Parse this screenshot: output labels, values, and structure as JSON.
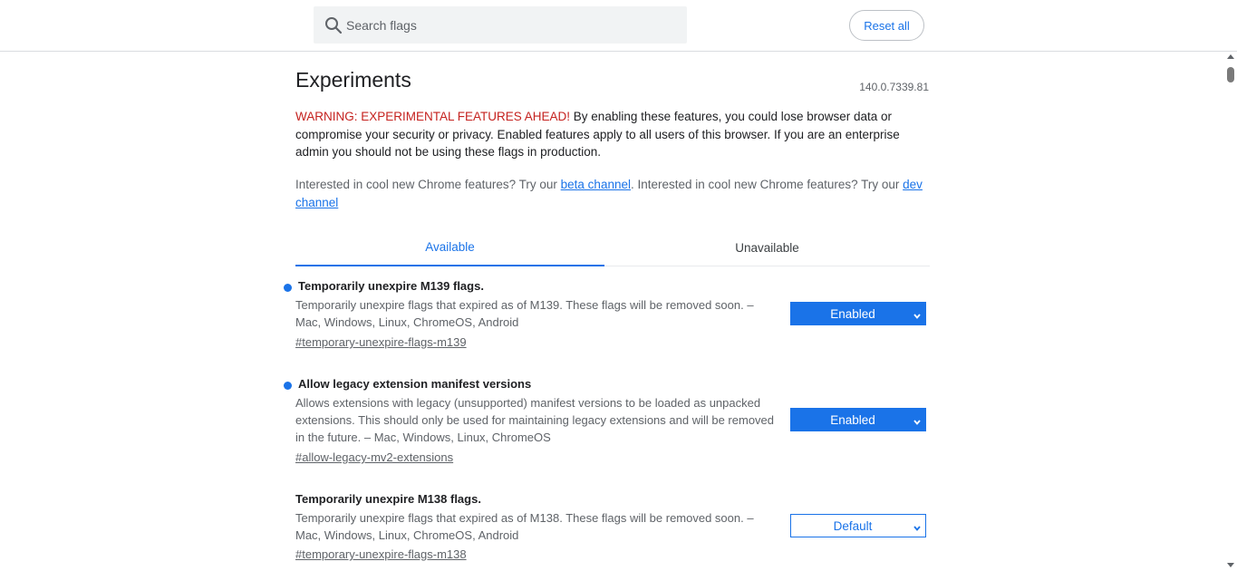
{
  "header": {
    "search_placeholder": "Search flags",
    "reset_label": "Reset all"
  },
  "page": {
    "title": "Experiments",
    "version": "140.0.7339.81",
    "warning_strong": "WARNING: EXPERIMENTAL FEATURES AHEAD!",
    "warning_text": " By enabling these features, you could lose browser data or compromise your security or privacy. Enabled features apply to all users of this browser. If you are an enterprise admin you should not be using these flags in production.",
    "promo_text_1": "Interested in cool new Chrome features? Try our ",
    "promo_link_1": "beta channel",
    "promo_text_2": ". Interested in cool new Chrome features? Try our ",
    "promo_link_2": "dev channel"
  },
  "tabs": [
    {
      "label": "Available",
      "active": true
    },
    {
      "label": "Unavailable",
      "active": false
    }
  ],
  "flags": [
    {
      "name": "Temporarily unexpire M139 flags.",
      "description": "Temporarily unexpire flags that expired as of M139. These flags will be removed soon. – Mac, Windows, Linux, ChromeOS, Android",
      "link": "#temporary-unexpire-flags-m139",
      "value": "Enabled",
      "modified": true
    },
    {
      "name": "Allow legacy extension manifest versions",
      "description": "Allows extensions with legacy (unsupported) manifest versions to be loaded as unpacked extensions. This should only be used for maintaining legacy extensions and will be removed in the future. – Mac, Windows, Linux, ChromeOS",
      "link": "#allow-legacy-mv2-extensions",
      "value": "Enabled",
      "modified": true
    },
    {
      "name": "Temporarily unexpire M138 flags.",
      "description": "Temporarily unexpire flags that expired as of M138. These flags will be removed soon. – Mac, Windows, Linux, ChromeOS, Android",
      "link": "#temporary-unexpire-flags-m138",
      "value": "Default",
      "modified": false
    }
  ],
  "colors": {
    "accent": "#1a73e8",
    "warning": "#c5221f",
    "secondary_text": "#5f6368"
  }
}
